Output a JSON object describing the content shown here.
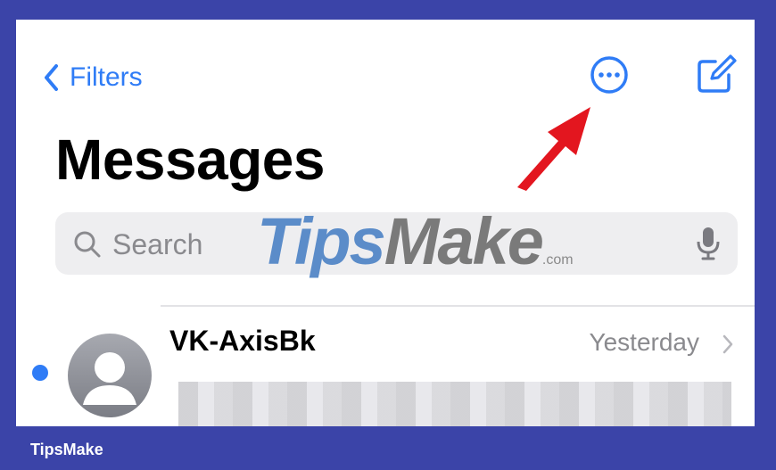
{
  "nav": {
    "back_label": "Filters"
  },
  "header": {
    "title": "Messages"
  },
  "search": {
    "placeholder": "Search"
  },
  "watermark": {
    "part1": "Tips",
    "part2": "Make",
    "suffix": ".com"
  },
  "conversations": [
    {
      "sender": "VK-AxisBk",
      "time": "Yesterday",
      "unread": true
    }
  ],
  "footer": {
    "brand": "TipsMake"
  },
  "colors": {
    "accent": "#2f7cf6",
    "frame": "#3b44a8",
    "annotation_arrow": "#e3161f"
  },
  "icons": {
    "back": "chevron-left-icon",
    "more": "ellipsis-circle-icon",
    "compose": "compose-icon",
    "search": "search-icon",
    "mic": "microphone-icon",
    "disclosure": "chevron-right-icon",
    "avatar": "person-icon"
  }
}
